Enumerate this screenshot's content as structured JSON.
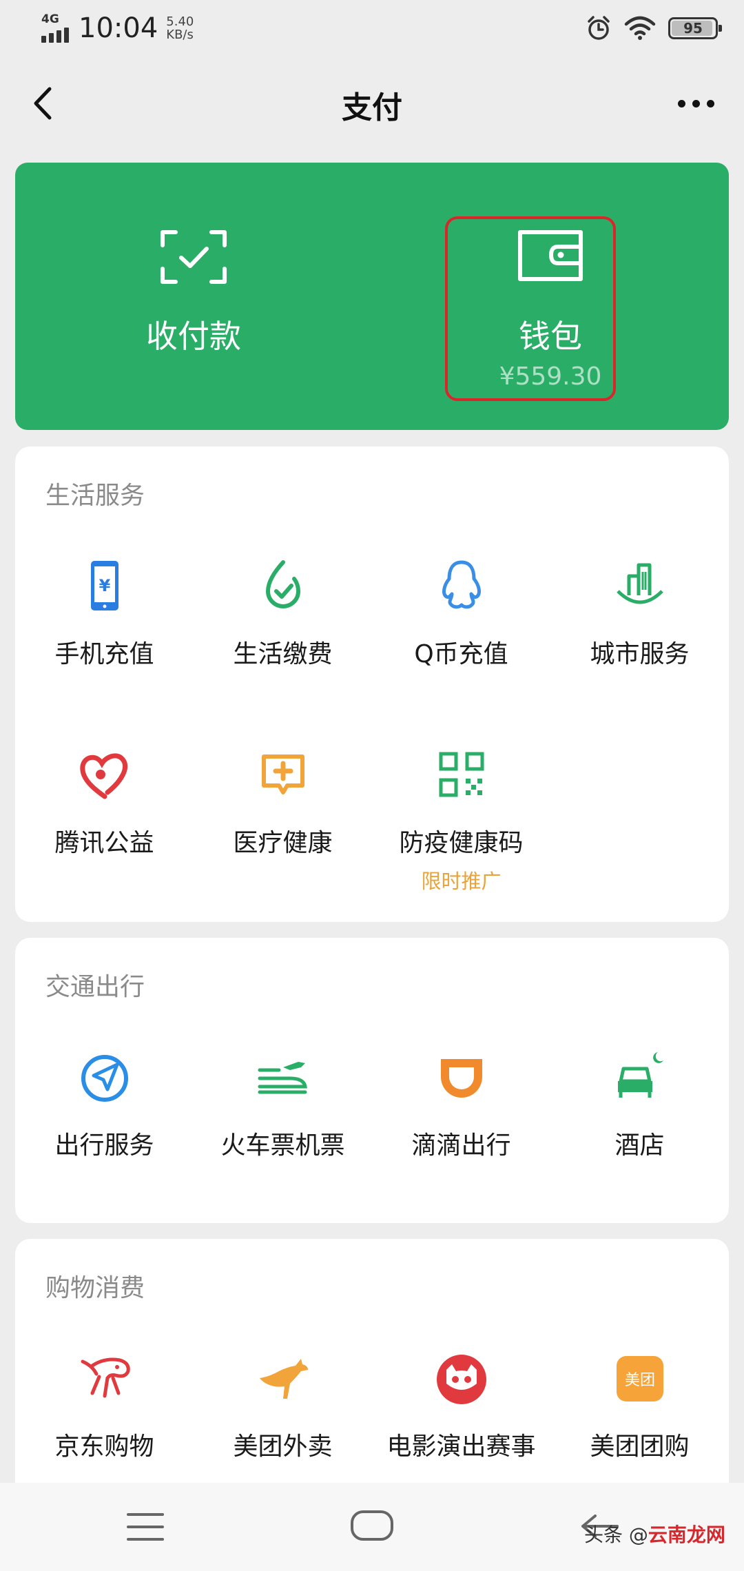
{
  "status_bar": {
    "network": "4G",
    "time": "10:04",
    "speed_value": "5.40",
    "speed_unit": "KB/s",
    "battery": "95",
    "battery_level_percent": 95
  },
  "nav": {
    "title": "支付",
    "back_icon": "chevron-left-icon",
    "more_icon": "more-dots-icon"
  },
  "pay_card": {
    "color": "#2aae67",
    "collect": {
      "label": "收付款",
      "icon": "scan-check-icon"
    },
    "wallet": {
      "label": "钱包",
      "balance": "¥559.30",
      "icon": "wallet-icon",
      "highlight_color": "#d9262b"
    }
  },
  "sections": {
    "life": {
      "title": "生活服务",
      "items": [
        {
          "label": "手机充值",
          "icon": "phone-recharge-icon",
          "color": "#2a7de1"
        },
        {
          "label": "生活缴费",
          "icon": "utility-bill-icon",
          "color": "#2aae67"
        },
        {
          "label": "Q币充值",
          "icon": "qq-penguin-icon",
          "color": "#3a8ee6"
        },
        {
          "label": "城市服务",
          "icon": "city-building-icon",
          "color": "#2aae67"
        },
        {
          "label": "腾讯公益",
          "icon": "charity-heart-icon",
          "color": "#e0393e"
        },
        {
          "label": "医疗健康",
          "icon": "medical-cross-icon",
          "color": "#f0a43a"
        },
        {
          "label": "防疫健康码",
          "icon": "qr-code-icon",
          "color": "#2aae67",
          "sub": "限时推广"
        }
      ]
    },
    "transport": {
      "title": "交通出行",
      "items": [
        {
          "label": "出行服务",
          "icon": "compass-arrow-icon",
          "color": "#2a8de6"
        },
        {
          "label": "火车票机票",
          "icon": "train-plane-icon",
          "color": "#2aae67"
        },
        {
          "label": "滴滴出行",
          "icon": "didi-icon",
          "color": "#f08a2c"
        },
        {
          "label": "酒店",
          "icon": "hotel-bed-icon",
          "color": "#2aae67"
        }
      ]
    },
    "shopping": {
      "title": "购物消费",
      "items": [
        {
          "label": "京东购物",
          "icon": "jd-dog-icon",
          "color": "#e0393e"
        },
        {
          "label": "美团外卖",
          "icon": "kangaroo-icon",
          "color": "#f0a43a"
        },
        {
          "label": "电影演出赛事",
          "icon": "cat-eye-icon",
          "color": "#e0393e"
        },
        {
          "label": "美团团购",
          "icon": "meituan-icon",
          "color": "#f6a33a",
          "badge_text": "美团"
        }
      ]
    }
  },
  "watermark": {
    "text_dark": "头条 @",
    "text_red": "云南龙网"
  }
}
